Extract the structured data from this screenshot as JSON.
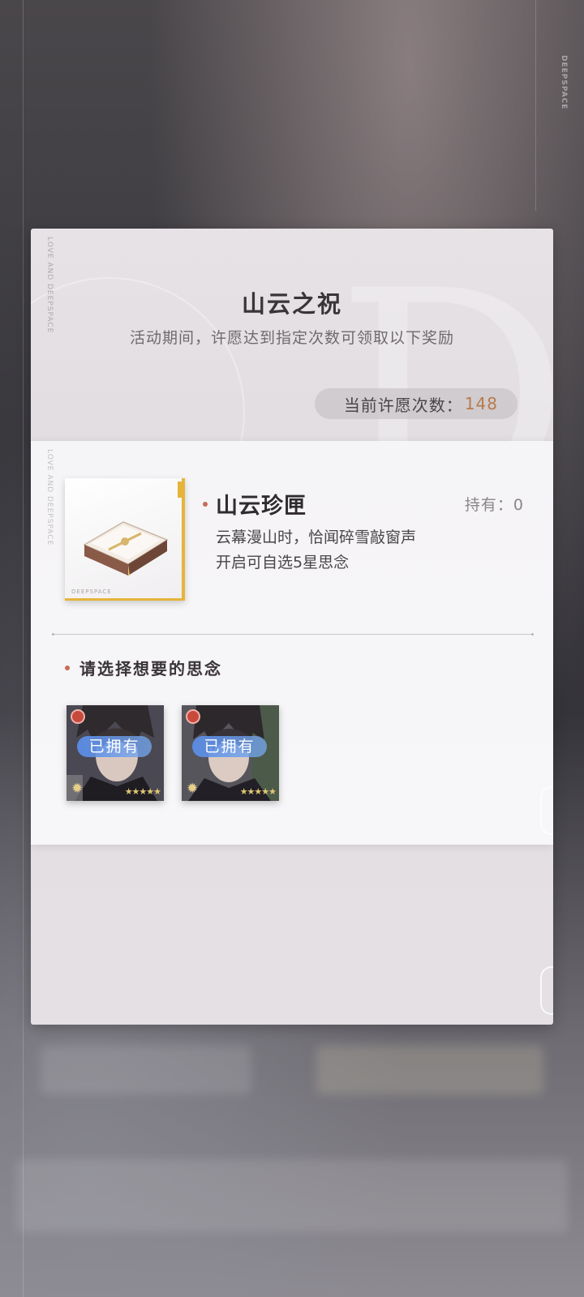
{
  "background": {
    "brand_text": "DEEPSPACE"
  },
  "dialog": {
    "side_text": "LOVE AND DEEPSPACE",
    "title": "山云之祝",
    "subtitle": "活动期间，许愿达到指定次数可领取以下奖励",
    "wish_count_label": "当前许愿次数：",
    "wish_count_value": "148"
  },
  "reward": {
    "side_text": "LOVE AND DEEPSPACE",
    "frame_brand": "DEEPSPACE",
    "item_name": "山云珍匣",
    "owned_label": "持有：0",
    "description_line1": "云幕漫山时，恰闻碎雪敲窗声",
    "description_line2": "开启可自选5星思念",
    "choose_label": "请选择想要的思念",
    "memories": [
      {
        "owned_tag": "已拥有",
        "stars": "★★★★★",
        "rarity": 5
      },
      {
        "owned_tag": "已拥有",
        "stars": "★★★★★",
        "rarity": 5
      }
    ]
  },
  "colors": {
    "accent_bullet": "#c76c58",
    "count_value": "#b87a4a",
    "rarity_gold": "#e6b43a",
    "owned_tag_blue": "#5a8ce6"
  }
}
